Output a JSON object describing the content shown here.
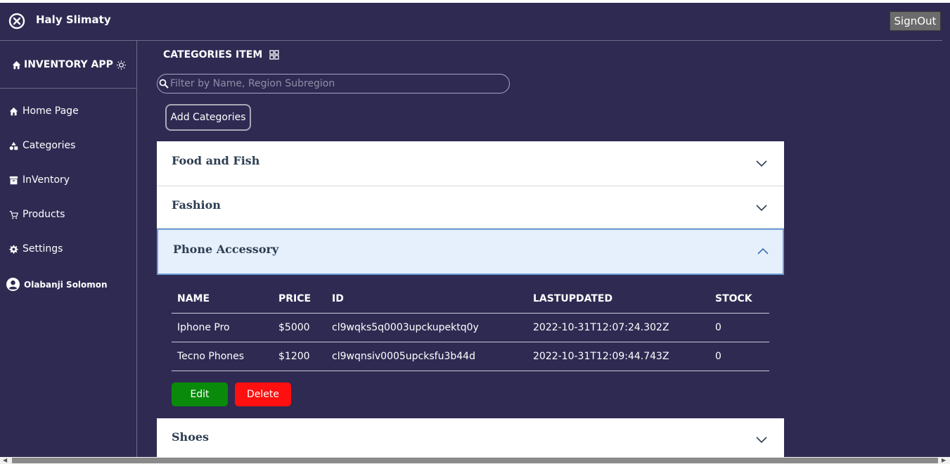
{
  "header": {
    "title": "Haly Slimaty",
    "signout_label": "SignOut"
  },
  "sidebar": {
    "brand": "INVENTORY APP",
    "items": [
      {
        "label": "Home Page",
        "icon": "home-icon"
      },
      {
        "label": "Categories",
        "icon": "shapes-icon"
      },
      {
        "label": "InVentory",
        "icon": "archive-icon"
      },
      {
        "label": "Products",
        "icon": "cart-icon"
      },
      {
        "label": "Settings",
        "icon": "gear-icon"
      }
    ],
    "user": "Olabanji Solomon"
  },
  "main": {
    "title": "CATEGORIES ITEM",
    "search": {
      "placeholder": "Filter by Name, Region Subregion",
      "value": ""
    },
    "add_label": "Add Categories",
    "categories": [
      {
        "label": "Food and Fish",
        "expanded": false
      },
      {
        "label": "Fashion",
        "expanded": false
      },
      {
        "label": "Phone Accessory",
        "expanded": true
      },
      {
        "label": "Shoes",
        "expanded": false
      }
    ],
    "table": {
      "headers": [
        "NAME",
        "PRICE",
        "ID",
        "LASTUPDATED",
        "STOCK"
      ],
      "rows": [
        [
          "Iphone Pro",
          "$5000",
          "cl9wqks5q0003upckupektq0y",
          "2022-10-31T12:07:24.302Z",
          "0"
        ],
        [
          "Tecno Phones",
          "$1200",
          "cl9wqnsiv0005upcksfu3b44d",
          "2022-10-31T12:09:44.743Z",
          "0"
        ]
      ]
    },
    "edit_label": "Edit",
    "delete_label": "Delete"
  },
  "colors": {
    "background": "#2e2a52",
    "edit": "#0a8a0a",
    "delete": "#ff0f0f",
    "expanded_header": "#e6f0fc"
  }
}
